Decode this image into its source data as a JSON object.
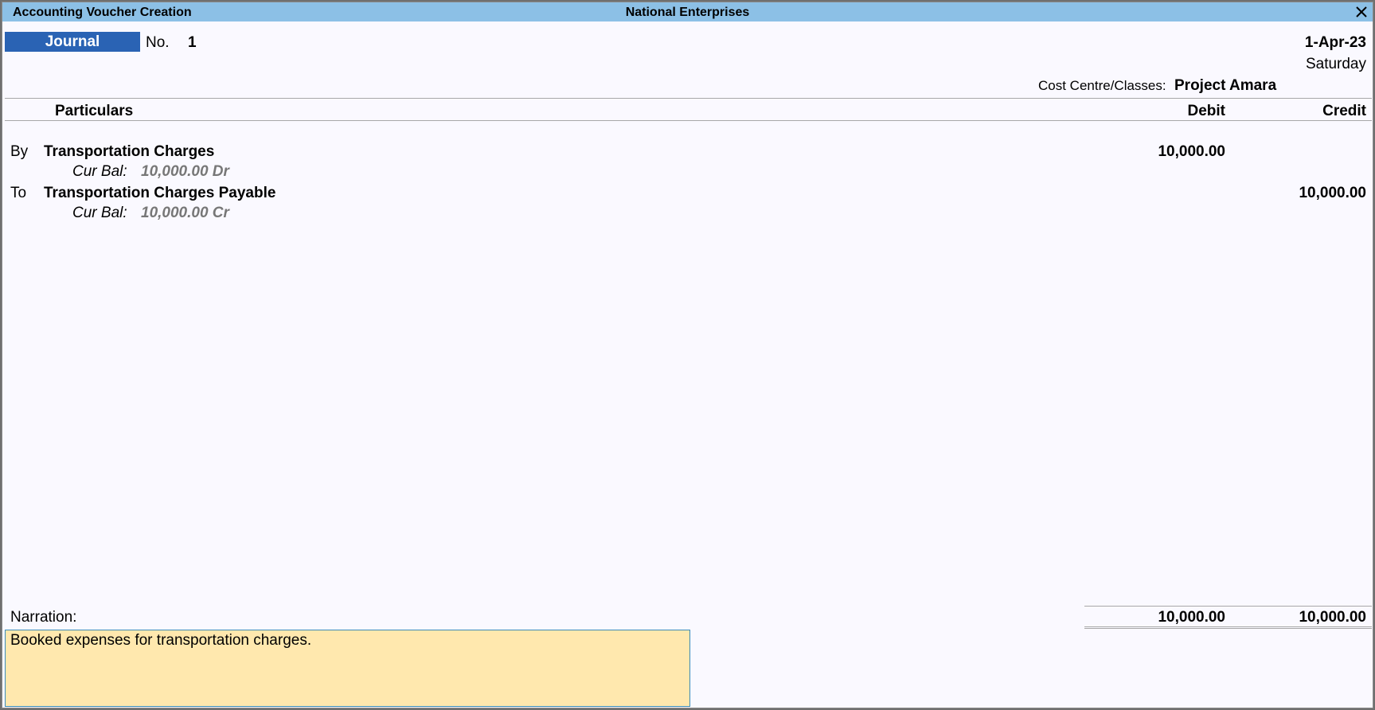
{
  "window": {
    "title": "Accounting Voucher Creation",
    "company": "National Enterprises",
    "close_icon": "close-icon"
  },
  "voucher": {
    "type": "Journal",
    "number_label": "No.",
    "number": "1",
    "date": "1-Apr-23",
    "day": "Saturday",
    "cost_centre_label": "Cost Centre/Classes:",
    "cost_centre_value": "Project Amara"
  },
  "columns": {
    "particulars": "Particulars",
    "debit": "Debit",
    "credit": "Credit"
  },
  "entries": [
    {
      "prefix": "By",
      "ledger": "Transportation Charges",
      "cur_bal_label": "Cur Bal:",
      "cur_bal_value": "10,000.00 Dr",
      "debit": "10,000.00",
      "credit": ""
    },
    {
      "prefix": "To",
      "ledger": "Transportation Charges Payable",
      "cur_bal_label": "Cur Bal:",
      "cur_bal_value": "10,000.00 Cr",
      "debit": "",
      "credit": "10,000.00"
    }
  ],
  "narration": {
    "label": "Narration:",
    "text": "Booked expenses for transportation charges."
  },
  "totals": {
    "debit": "10,000.00",
    "credit": "10,000.00"
  }
}
